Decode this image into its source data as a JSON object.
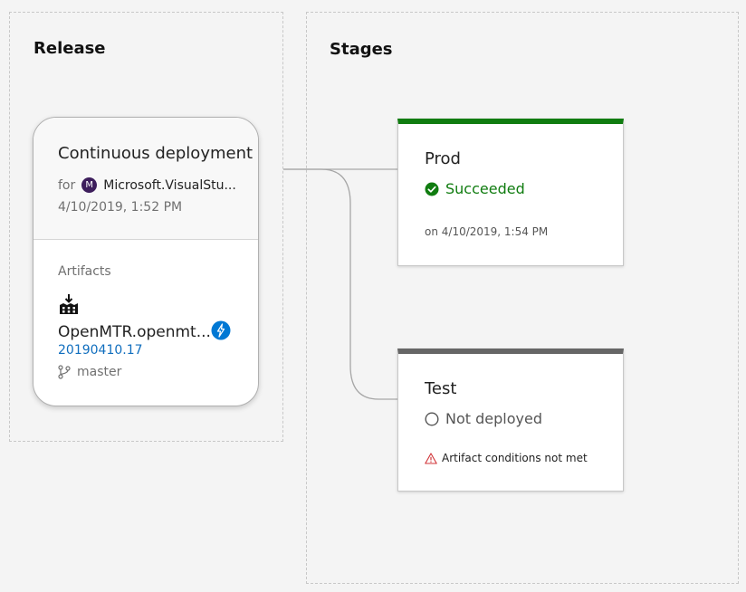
{
  "release": {
    "title": "Release",
    "card": {
      "title": "Continuous deployment",
      "for_label": "for",
      "project_initial": "M",
      "project_name": "Microsoft.VisualStu...",
      "date": "4/10/2019, 1:52 PM",
      "artifacts_label": "Artifacts",
      "artifact_name": "OpenMTR.openmt...",
      "artifact_version": "20190410.17",
      "branch": "master"
    }
  },
  "stages": {
    "title": "Stages",
    "items": [
      {
        "name": "Prod",
        "status": "Succeeded",
        "status_color": "#107c10",
        "meta": "on 4/10/2019, 1:54 PM",
        "icon": "check-circle-icon"
      },
      {
        "name": "Test",
        "status": "Not deployed",
        "status_color": "#555555",
        "warning": "Artifact conditions not met",
        "icon": "empty-circle-icon"
      }
    ]
  },
  "colors": {
    "success": "#107c10",
    "link": "#106ebe",
    "avatar": "#3d1e5c",
    "trigger": "#0078d4",
    "warning": "#d13438"
  }
}
